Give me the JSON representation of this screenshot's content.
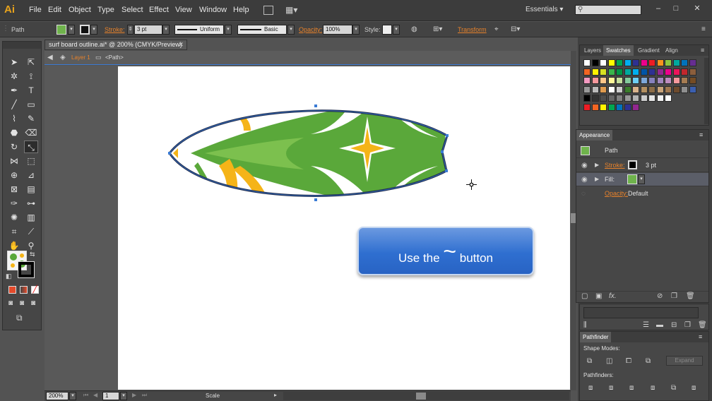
{
  "app": {
    "logo": "Ai"
  },
  "menus": [
    "File",
    "Edit",
    "Object",
    "Type",
    "Select",
    "Effect",
    "View",
    "Window",
    "Help"
  ],
  "workspace": {
    "label": "Essentials",
    "search_placeholder": ""
  },
  "window_buttons": {
    "minimize": "–",
    "maximize": "□",
    "close": "✕"
  },
  "control": {
    "selection": "Path",
    "stroke_label": "Stroke:",
    "stroke_weight": "3 pt",
    "profile": "Uniform",
    "brush": "Basic",
    "opacity_label": "Opacity:",
    "opacity_value": "100%",
    "style_label": "Style:",
    "transform_label": "Transform"
  },
  "document": {
    "tab_title": "surf board outline.ai* @ 200% (CMYK/Preview)",
    "layer": "Layer 1",
    "path_crumb": "<Path>",
    "zoom": "200%",
    "artboard_num": "1",
    "status": "Scale"
  },
  "callout": {
    "prefix": "Use the",
    "symbol": "~",
    "suffix": "button"
  },
  "panels": {
    "swatches_tabs": [
      "Layers",
      "Swatches",
      "Gradient",
      "Align"
    ],
    "appearance": {
      "title": "Appearance",
      "object": "Path",
      "stroke_label": "Stroke:",
      "stroke_value": "3 pt",
      "fill_label": "Fill:",
      "opacity_label": "Opacity:",
      "opacity_value": "Default"
    },
    "pathfinder": {
      "title": "Pathfinder",
      "shape_modes": "Shape Modes:",
      "pathfinders": "Pathfinders:",
      "expand": "Expand"
    }
  },
  "colors": {
    "accent_blue": "#3a7bd5",
    "orange_label": "#e7822b",
    "board_green": "#5aa83a",
    "board_yellow": "#f5b418",
    "ui_dark": "#535353"
  },
  "swatch_rows": [
    [
      "#ffffff",
      "#000000",
      "#ffffff",
      "#ffff00",
      "#00a651",
      "#00aeef",
      "#2e3192",
      "#ec008c",
      "#ed1c24",
      "#f7941d",
      "#8dc63f",
      "#00a99d",
      "#0072bc",
      "#662d91"
    ],
    [
      "#f26522",
      "#fff200",
      "#d7e021",
      "#39b54a",
      "#009444",
      "#00a99d",
      "#00aeef",
      "#0054a6",
      "#2e3192",
      "#92278f",
      "#ec008c",
      "#ed145b",
      "#c1272d",
      "#8b5e3c"
    ],
    [
      "#f49ac1",
      "#f5989d",
      "#fdc689",
      "#fff799",
      "#c4df9b",
      "#82ca9c",
      "#6dcff6",
      "#7da7d9",
      "#8781bd",
      "#a186be",
      "#bd8cbf",
      "#f6989d",
      "#a67c52",
      "#754c24"
    ],
    [
      "#999999",
      "#bbbbbb",
      "#e09b4f",
      "#ffffff",
      "#cccccc",
      "#3a7d2c",
      "#d9b38c",
      "#b38f60",
      "#8c6d48",
      "#c9a47a",
      "#a07850",
      "#6e4b2e",
      "#8f8f8f",
      "#3b5fb0"
    ],
    [
      "#000000",
      "#333333",
      "#4d4d4d",
      "#666666",
      "#808080",
      "#999999",
      "#b3b3b3",
      "#cccccc",
      "#e6e6e6",
      "#f2f2f2",
      "#ffffff"
    ],
    [
      "#ed1c24",
      "#f26522",
      "#fff200",
      "#00a651",
      "#0072bc",
      "#2e3192",
      "#92278f"
    ]
  ]
}
